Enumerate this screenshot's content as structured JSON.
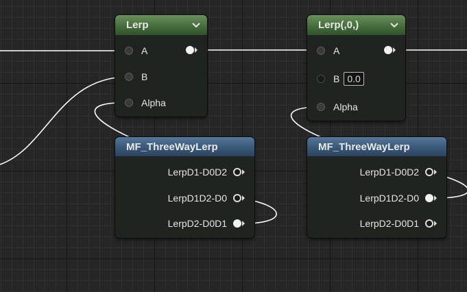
{
  "nodes": {
    "lerp1": {
      "title": "Lerp",
      "pins": {
        "a": "A",
        "b": "B",
        "alpha": "Alpha"
      }
    },
    "lerp2": {
      "title": "Lerp(,0,)",
      "pins": {
        "a": "A",
        "b": "B",
        "b_value": "0.0",
        "alpha": "Alpha"
      }
    },
    "mf1": {
      "title": "MF_ThreeWayLerp",
      "outputs": [
        "LerpD1-D0D2",
        "LerpD1D2-D0",
        "LerpD2-D0D1"
      ]
    },
    "mf2": {
      "title": "MF_ThreeWayLerp",
      "outputs": [
        "LerpD1-D0D2",
        "LerpD1D2-D0",
        "LerpD2-D0D1"
      ]
    }
  },
  "colors": {
    "lerp_header": "#456e3c",
    "function_header": "#3a5878",
    "wire": "#ffffff",
    "grid_background": "#262626"
  },
  "icons": {
    "collapse": "chevron-down-icon",
    "pin_output": "exec-output-pin-icon"
  }
}
